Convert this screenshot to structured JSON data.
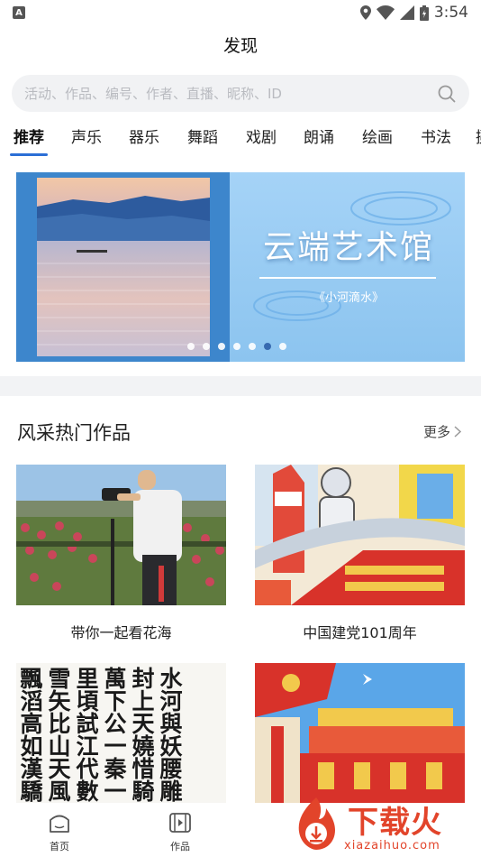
{
  "status_bar": {
    "left_badge": "A",
    "time": "3:54"
  },
  "header": {
    "title": "发现"
  },
  "search": {
    "placeholder": "活动、作品、编号、作者、直播、昵称、ID"
  },
  "tabs": [
    {
      "label": "推荐",
      "active": true
    },
    {
      "label": "声乐"
    },
    {
      "label": "器乐"
    },
    {
      "label": "舞蹈"
    },
    {
      "label": "戏剧"
    },
    {
      "label": "朗诵"
    },
    {
      "label": "绘画"
    },
    {
      "label": "书法"
    },
    {
      "label": "摄"
    }
  ],
  "banner": {
    "title": "云端艺术馆",
    "subtitle": "《小河滴水》",
    "dot_count": 7,
    "active_dot_index": 5
  },
  "section": {
    "title": "风采热门作品",
    "more_label": "更多"
  },
  "works": [
    {
      "caption": "带你一起看花海"
    },
    {
      "caption": "中国建党101周年"
    },
    {
      "caption": ""
    },
    {
      "caption": ""
    }
  ],
  "calligraphy_text": "水河與妖腰雕 封上天嬈惜騎 萬下公一秦一 里頃試江代數 雪矢比山天風 飄滔高如漢驕",
  "bottom_nav": [
    {
      "label": "首页",
      "icon": "home-icon"
    },
    {
      "label": "作品",
      "icon": "video-icon"
    }
  ],
  "watermark": {
    "text": "下载火",
    "url": "xiazaihuo.com"
  },
  "colors": {
    "accent": "#2b6fd6",
    "banner_blue": "#3d86cc",
    "watermark_red": "#e2442a"
  }
}
